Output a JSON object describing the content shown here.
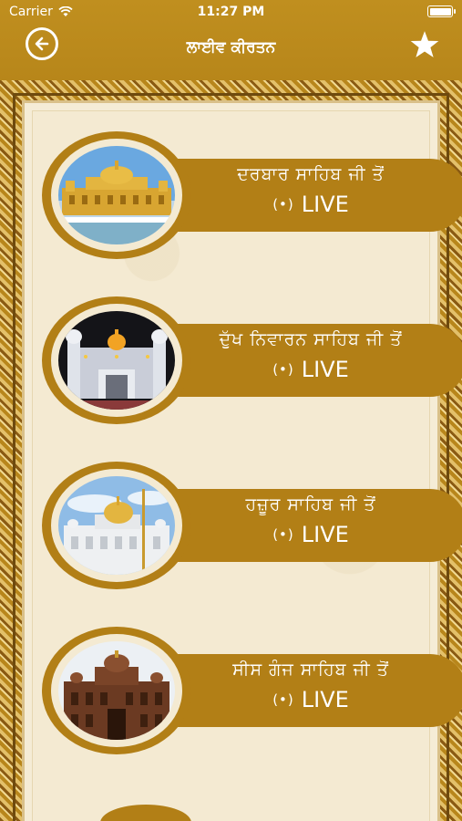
{
  "status_bar": {
    "carrier": "Carrier",
    "time": "11:27 PM"
  },
  "nav": {
    "title": "ਲਾਈਵ ਕੀਰਤਨ"
  },
  "colors": {
    "gold": "#b27f16",
    "cream": "#f4ead2"
  },
  "shrines": [
    {
      "name": "ਦਰਬਾਰ ਸਾਹਿਬ ਜੀ ਤੋਂ",
      "live_label": "LIVE",
      "live_icon": "(•)"
    },
    {
      "name": "ਦੁੱਖ ਨਿਵਾਰਨ ਸਾਹਿਬ ਜੀ ਤੋਂ",
      "live_label": "LIVE",
      "live_icon": "(•)"
    },
    {
      "name": "ਹਜ਼ੂਰ ਸਾਹਿਬ ਜੀ ਤੋਂ",
      "live_label": "LIVE",
      "live_icon": "(•)"
    },
    {
      "name": "ਸੀਸ ਗੰਜ ਸਾਹਿਬ ਜੀ ਤੋਂ",
      "live_label": "LIVE",
      "live_icon": "(•)"
    }
  ]
}
